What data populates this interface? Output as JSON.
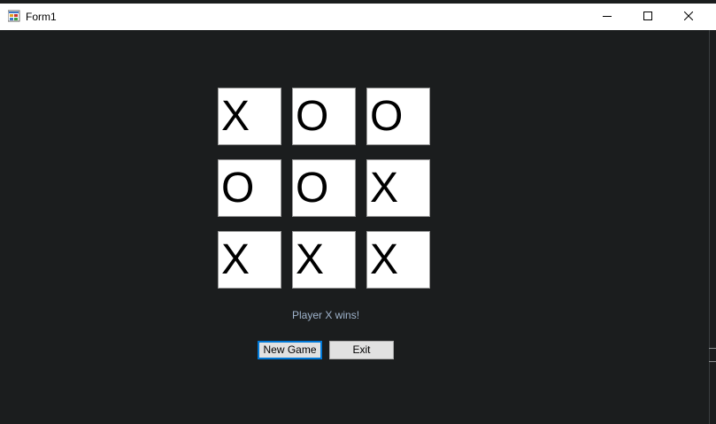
{
  "window": {
    "title": "Form1"
  },
  "board": {
    "cells": [
      "X",
      "O",
      "O",
      "O",
      "O",
      "X",
      "X",
      "X",
      "X"
    ]
  },
  "status": {
    "message": "Player X wins!"
  },
  "buttons": {
    "new_game": "New Game",
    "exit": "Exit"
  },
  "colors": {
    "background": "#1b1d1e",
    "status_text": "#9fb3cc",
    "focus_border": "#0078d7"
  }
}
